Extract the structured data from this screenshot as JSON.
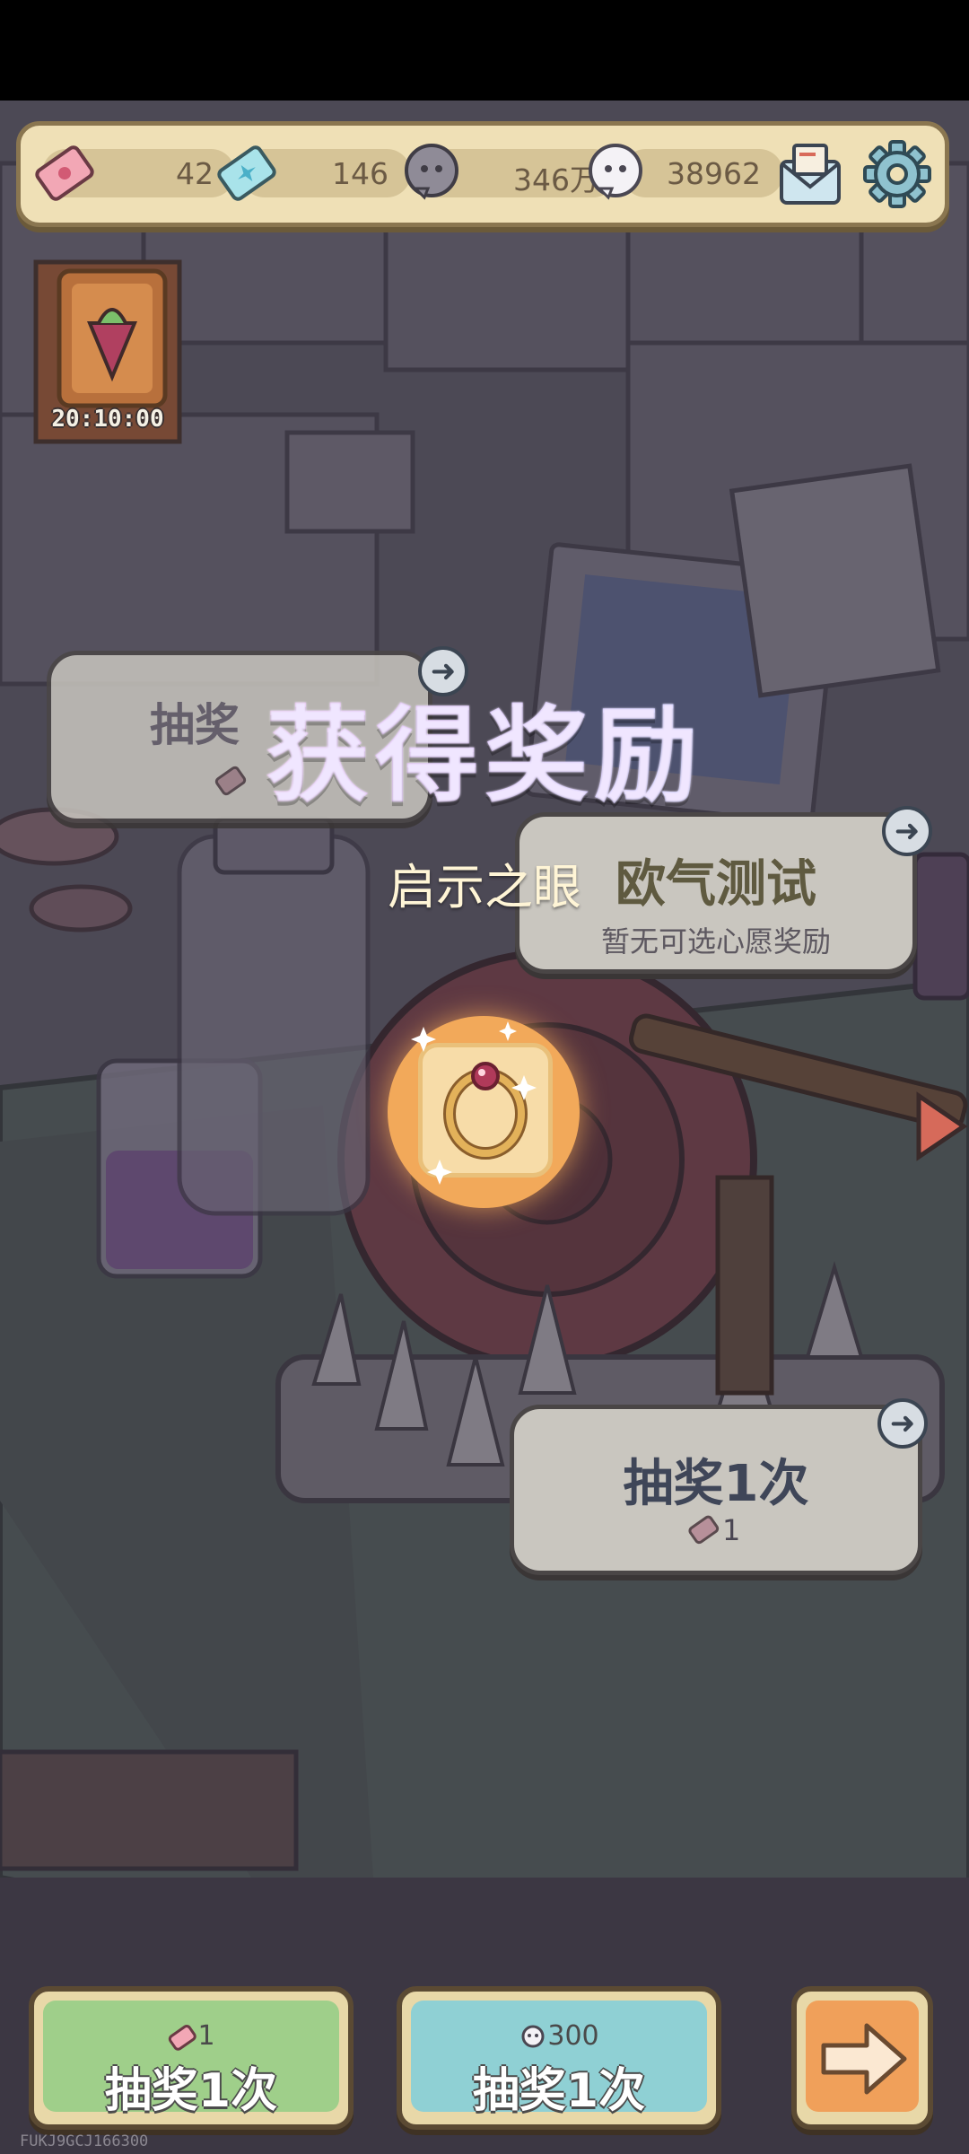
{
  "resources": {
    "ticket_pink": "42",
    "ticket_blue": "146",
    "soul_gray": "346万",
    "soul_white": "38962"
  },
  "event_timer": "20:10:00",
  "scene_buttons": {
    "left_card_title": "抽奖",
    "test_card": {
      "title": "欧气测试",
      "subtitle": "暂无可选心愿奖励"
    },
    "draw_card": {
      "title": "抽奖1次",
      "cost": "1"
    }
  },
  "reward_popup": {
    "title": "获得奖励",
    "item_name": "启示之眼",
    "item_icon": "ring-icon"
  },
  "bottom_buttons": {
    "ticket_draw": {
      "cost": "1",
      "label": "抽奖1次"
    },
    "soul_draw": {
      "cost": "300",
      "label": "抽奖1次"
    },
    "next": {
      "icon": "arrow-right-icon"
    }
  },
  "build_id": "FUKJ9GCJ166300",
  "colors": {
    "ticket_button": "#9fcf8a",
    "soul_button": "#8fd0d4",
    "next_button": "#f0a05a",
    "reward_glow": "#f2a95a"
  }
}
